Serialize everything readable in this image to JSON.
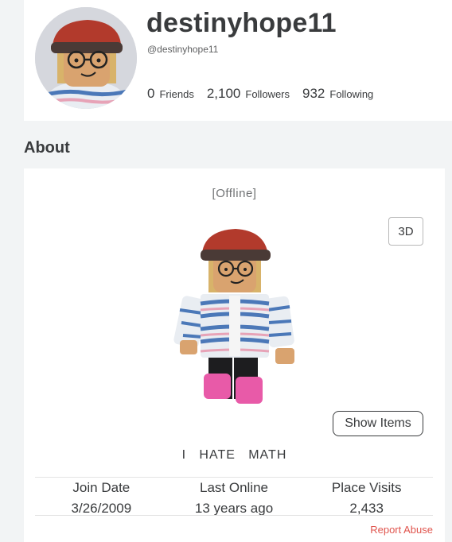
{
  "profile": {
    "display_name": "destinyhope11",
    "handle": "@destinyhope11",
    "stats": [
      {
        "count": "0",
        "label": "Friends"
      },
      {
        "count": "2,100",
        "label": "Followers"
      },
      {
        "count": "932",
        "label": "Following"
      }
    ]
  },
  "about": {
    "title": "About",
    "status": "[Offline]",
    "btn_3d": "3D",
    "show_items": "Show Items",
    "bio": "I   HATE   MATH",
    "info": [
      {
        "label": "Join Date",
        "value": "3/26/2009"
      },
      {
        "label": "Last Online",
        "value": "13 years ago"
      },
      {
        "label": "Place Visits",
        "value": "2,433"
      }
    ],
    "report": "Report Abuse"
  },
  "colors": {
    "accent_red": "#e0554e",
    "text": "#393b3d",
    "hat": "#b23a2c",
    "skin": "#d9a36f",
    "boots": "#e85aa8"
  }
}
